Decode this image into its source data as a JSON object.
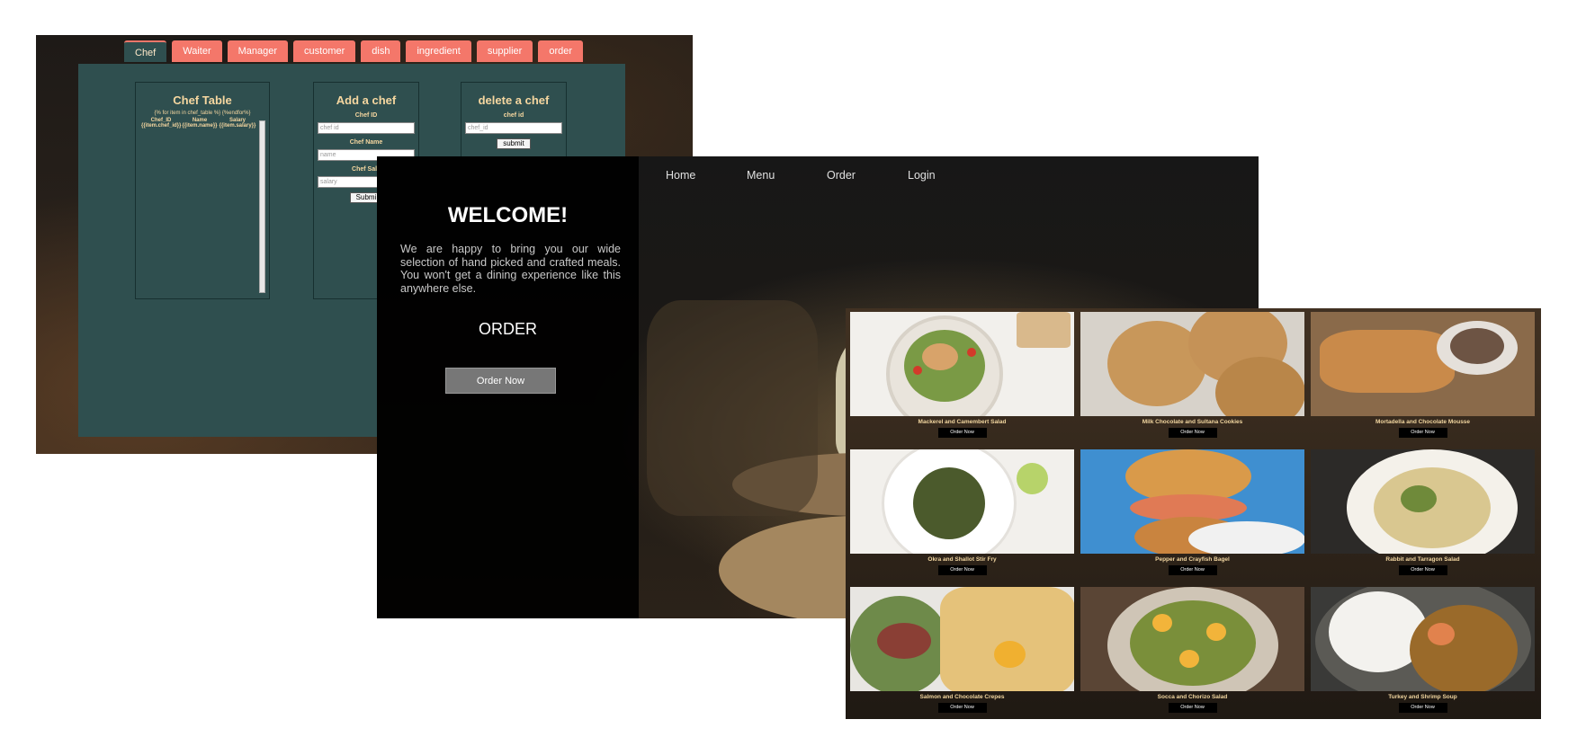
{
  "admin": {
    "tabs": [
      "Chef",
      "Waiter",
      "Manager",
      "customer",
      "dish",
      "ingredient",
      "supplier",
      "order"
    ],
    "chef_table": {
      "title": "Chef Table",
      "template_open": "{% for item in chef_table %} {%endfor%}",
      "columns": [
        "Chef_ID",
        "Name",
        "Salary"
      ],
      "cells": [
        "{{item.chef_id}}",
        "{{item.name}}",
        "{{item.salary}}"
      ]
    },
    "add_chef": {
      "title": "Add a chef",
      "id_label": "Chef ID",
      "id_placeholder": "chef id",
      "name_label": "Chef Name",
      "name_placeholder": "name",
      "salary_label": "Chef Sala",
      "salary_placeholder": "salary",
      "submit": "Submi"
    },
    "delete_chef": {
      "title": "delete a chef",
      "id_label": "chef id",
      "id_placeholder": "chef_id",
      "submit": "submit"
    }
  },
  "home": {
    "nav": [
      "Home",
      "Menu",
      "Order",
      "Login"
    ],
    "welcome": "WELCOME!",
    "intro": "We are happy to bring you our wide selection of hand picked and crafted meals. You won't get a dining experience like this anywhere else.",
    "order_heading": "ORDER",
    "order_button": "Order Now"
  },
  "menu": {
    "button_label": "Order Now",
    "dishes": [
      {
        "name": "Mackerel and Camembert Salad",
        "icon": "salad-photo"
      },
      {
        "name": "Milk Chocolate and Sultana Cookies",
        "icon": "cookies-photo"
      },
      {
        "name": "Mortadella and Chocolate Mousse",
        "icon": "toast-photo"
      },
      {
        "name": "Okra and Shallot Stir Fry",
        "icon": "okra-photo"
      },
      {
        "name": "Pepper and Crayfish Bagel",
        "icon": "bagel-photo"
      },
      {
        "name": "Rabbit and Tarragon Salad",
        "icon": "pasta-photo"
      },
      {
        "name": "Salmon and Chocolate Crepes",
        "icon": "crepes-photo"
      },
      {
        "name": "Socca and Chorizo Salad",
        "icon": "egg-salad-photo"
      },
      {
        "name": "Turkey and Shrimp Soup",
        "icon": "gumbo-photo"
      }
    ]
  }
}
